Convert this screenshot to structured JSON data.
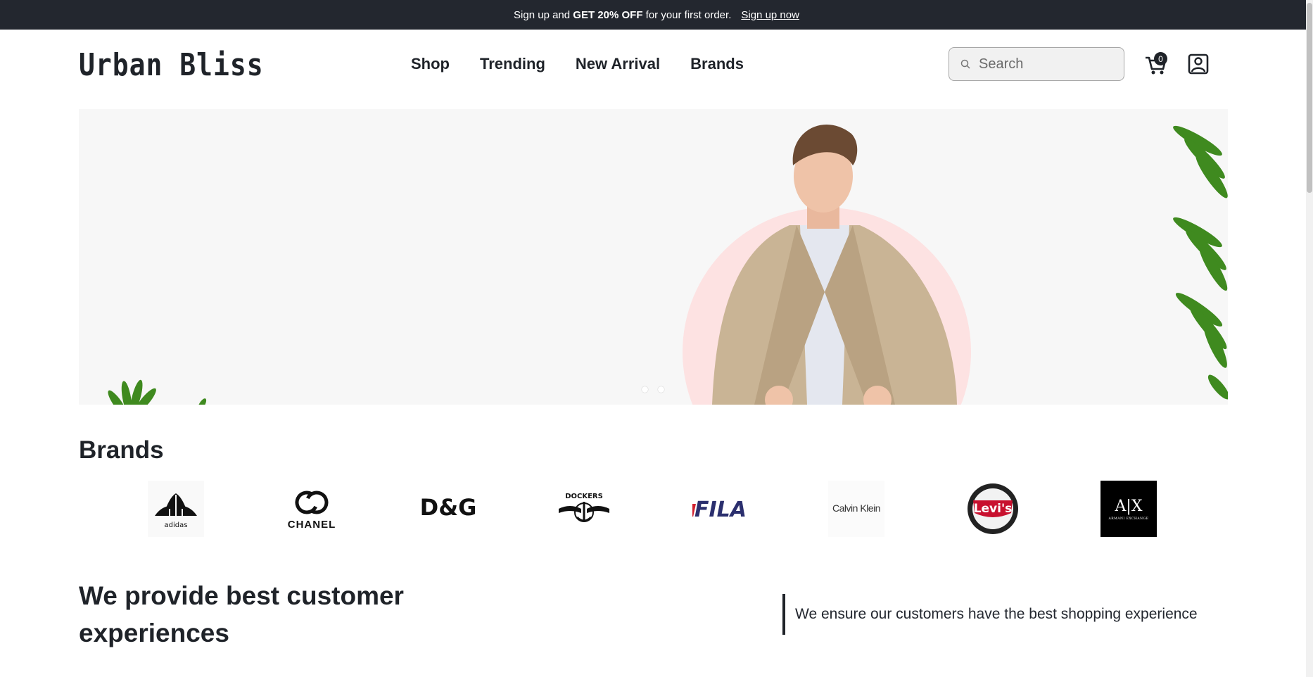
{
  "announcement": {
    "prefix": "Sign up and",
    "highlight": "GET 20% OFF",
    "suffix": "for your first order.",
    "link": "Sign up now"
  },
  "header": {
    "logo": "Urban Bliss",
    "nav": [
      "Shop",
      "Trending",
      "New Arrival",
      "Brands"
    ],
    "search_placeholder": "Search",
    "cart_count": "0"
  },
  "hero": {
    "slide_count": 2,
    "active_slide": 1,
    "accent_color": "#fde2e2"
  },
  "brands": {
    "title": "Brands",
    "logos": [
      "adidas",
      "CHANEL",
      "D&G",
      "DOCKERS",
      "FILA",
      "Calvin Klein",
      "Levi's",
      "A|X"
    ],
    "armani_sub": "ARMANI EXCHANGE"
  },
  "customer": {
    "title": "We provide best customer experiences",
    "description": "We ensure our customers have the best shopping experience"
  },
  "colors": {
    "topbar": "#23272f",
    "text": "#1f2329",
    "fila_blue": "#2b2f6e",
    "fila_red": "#d0202e",
    "levis_red": "#c8102e"
  }
}
